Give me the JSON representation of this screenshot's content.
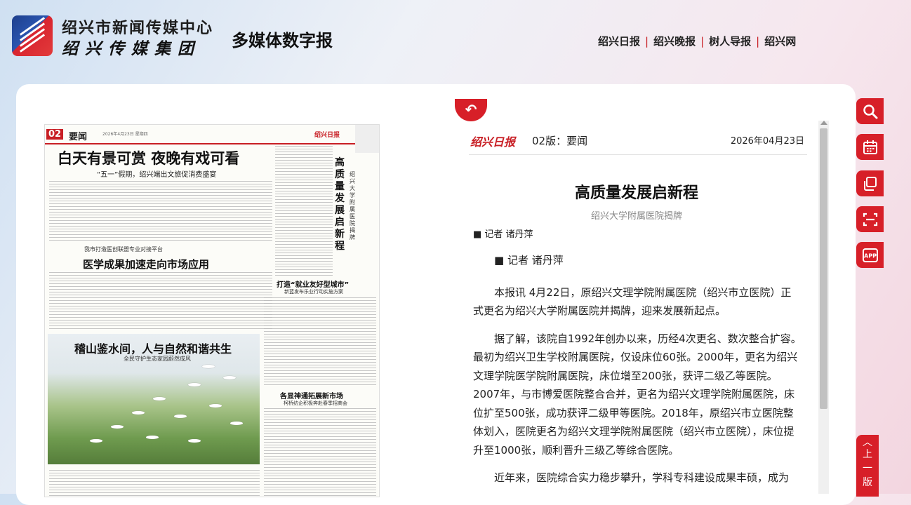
{
  "header": {
    "brand_line1": "绍兴市新闻传媒中心",
    "brand_line2": "绍兴传媒集团",
    "brand_sub": "多媒体数字报",
    "links": [
      "绍兴日报",
      "绍兴晚报",
      "树人导报",
      "绍兴网"
    ]
  },
  "paper": {
    "page_number": "02",
    "section": "要闻",
    "date_line": "2026年4月23日 星期四",
    "masthead": "绍兴日报",
    "headline": "白天有景可赏 夜晚有戏可看",
    "headline_sub": "“五一”假期，绍兴端出文旅促消费盛宴",
    "story2_kicker": "我市打造医创联盟专业对接平台",
    "story2_title": "医学成果加速走向市场应用",
    "photo_title": "稽山鉴水间，人与自然和谐共生",
    "photo_sub": "全民守护生态家园蔚然成风",
    "vertical_title": "高质量发展启新程",
    "vertical_sub": "绍兴大学附属医院揭牌",
    "story3_title": "打造“就业友好型城市”",
    "story3_sub": "新蓝发布乐业行动实施方案",
    "story4_title": "各显神通拓展新市场",
    "story4_sub": "柯桥纺企积极奔赴春季招商会"
  },
  "article": {
    "back_icon": "return-arrow-icon",
    "paper_logo": "绍兴日报",
    "page_label": "02版：要闻",
    "date": "2026年04月23日",
    "title": "高质量发展启新程",
    "subtitle": "绍兴大学附属医院揭牌",
    "author_top": "■ 记者 诸丹萍",
    "author_inline": "■ 记者 诸丹萍",
    "paragraphs": [
      "本报讯 4月22日，原绍兴文理学院附属医院（绍兴市立医院）正式更名为绍兴大学附属医院并揭牌，迎来发展新起点。",
      "据了解，该院自1992年创办以来，历经4次更名、数次整合扩容。最初为绍兴卫生学校附属医院，仅设床位60张。2000年，更名为绍兴文理学院医学院附属医院，床位增至200张，获评二级乙等医院。2007年，与市博爱医院整合合并，更名为绍兴文理学院附属医院，床位扩至500张，成功获评二级甲等医院。2018年，原绍兴市立医院整体划入，医院更名为绍兴文理学院附属医院（绍兴市立医院），床位提升至1000张，顺利晋升三级乙等综合医院。",
      "近年来，医院综合实力稳步攀升，学科专科建设成果丰硕，成为"
    ]
  },
  "sidebar": {
    "buttons": [
      "search-icon",
      "calendar-icon",
      "copy-icon",
      "scan-icon",
      "app-icon"
    ],
    "app_label": "APP",
    "prev_chevron": "︿",
    "prev_label": [
      "上",
      "一",
      "版"
    ]
  },
  "colors": {
    "accent": "#d71f28",
    "text": "#222222",
    "muted": "#888888"
  }
}
